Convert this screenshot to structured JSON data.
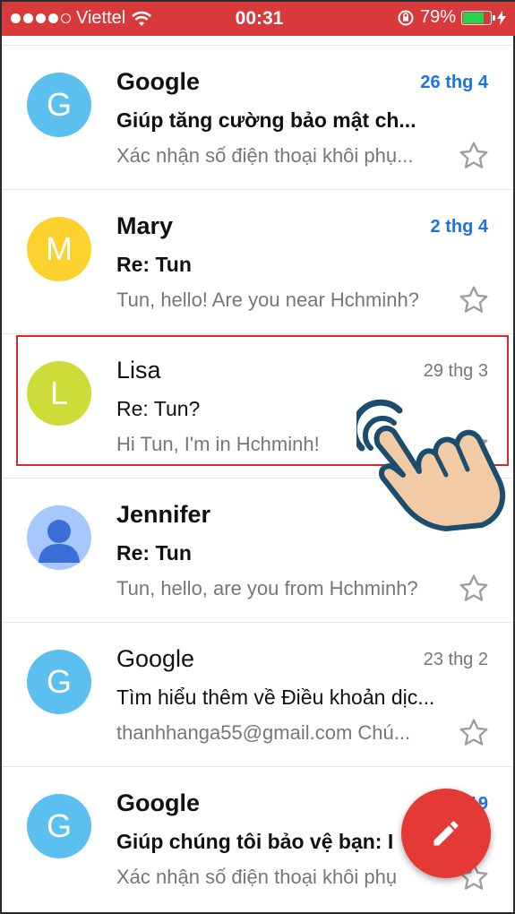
{
  "status_bar": {
    "carrier": "Viettel",
    "time": "00:31",
    "battery_percent": "79%",
    "battery_level": 0.79,
    "signal_bars": 4,
    "icons": [
      "signal-dots-icon",
      "wifi-icon",
      "rotation-lock-icon",
      "battery-icon",
      "charging-bolt-icon"
    ]
  },
  "emails": [
    {
      "sender": "Google",
      "initial": "G",
      "avatar_color": "#5bc0f0",
      "subject": "Giúp tăng cường bảo mật ch...",
      "snippet": "Xác nhận số điện thoại khôi phụ...",
      "date": "26 thg 4",
      "unread": true
    },
    {
      "sender": "Mary",
      "initial": "M",
      "avatar_color": "#fcd22f",
      "subject": "Re: Tun",
      "snippet": "Tun, hello! Are you near Hchminh?",
      "date": "2 thg 4",
      "unread": true
    },
    {
      "sender": "Lisa",
      "initial": "L",
      "avatar_color": "#cddc39",
      "subject": "Re: Tun?",
      "snippet": "Hi Tun, I'm in Hchminh!",
      "date": "29 thg 3",
      "unread": false
    },
    {
      "sender": "Jennifer",
      "initial": "",
      "avatar_color": "#a6c8ff",
      "subject": "Re: Tun",
      "snippet": "Tun, hello, are you from Hchminh?",
      "date": "",
      "unread": true
    },
    {
      "sender": "Google",
      "initial": "G",
      "avatar_color": "#5bc0f0",
      "subject": "Tìm hiểu thêm về Điều khoản dịc...",
      "snippet": "thanhhanga55@gmail.com Chú...",
      "date": "23 thg 2",
      "unread": false
    },
    {
      "sender": "Google",
      "initial": "G",
      "avatar_color": "#5bc0f0",
      "subject": "Giúp chúng tôi bảo vệ bạn: I",
      "snippet": "Xác nhận số điện thoại khôi phụ",
      "date": "31/12/19",
      "unread": true
    }
  ],
  "compose_icon": "pencil-icon",
  "accent_red": "#e53935",
  "highlight_color": "#d62b2b"
}
